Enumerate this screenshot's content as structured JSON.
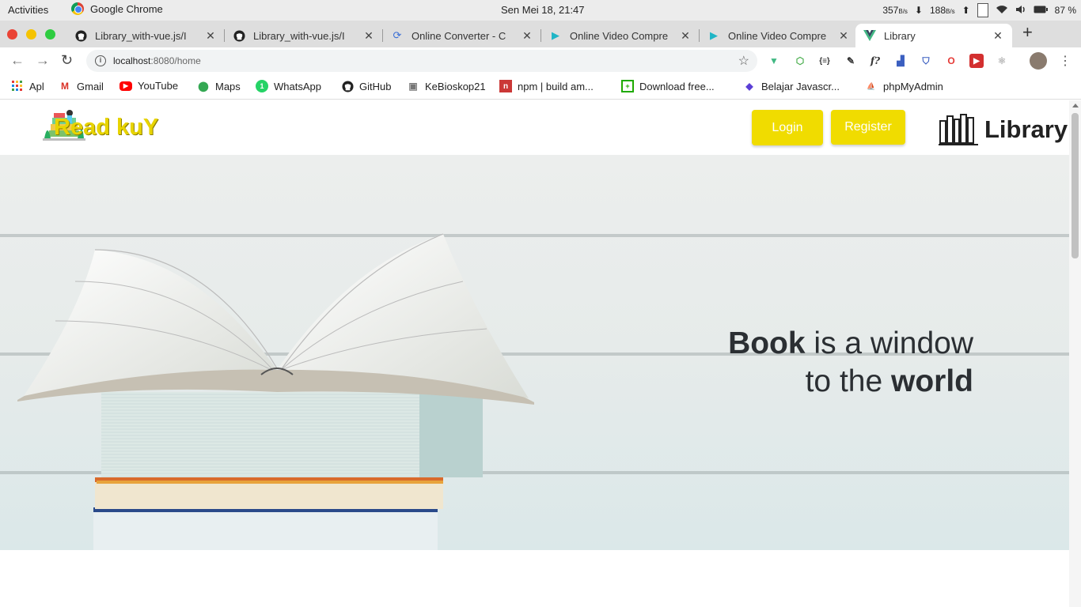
{
  "system_bar": {
    "activities": "Activities",
    "app_name": "Google Chrome",
    "clock": "Sen Mei 18, 21:47",
    "download_speed": "357",
    "download_unit": "B/s",
    "upload_speed": "188",
    "upload_unit": "B/s",
    "battery": "87 %"
  },
  "tabs": [
    {
      "title": "Library_with-vue.js/I",
      "icon": "github-icon"
    },
    {
      "title": "Library_with-vue.js/I",
      "icon": "github-icon"
    },
    {
      "title": "Online Converter - C",
      "icon": "converter-icon"
    },
    {
      "title": "Online Video Compre",
      "icon": "video-compress-icon"
    },
    {
      "title": "Online Video Compre",
      "icon": "video-compress-icon"
    },
    {
      "title": "Library",
      "icon": "vue-icon",
      "active": true
    }
  ],
  "address_bar": {
    "host": "localhost",
    "path": ":8080/home"
  },
  "bookmarks": [
    {
      "label": "Apl",
      "icon": "apps-grid-icon"
    },
    {
      "label": "Gmail",
      "icon": "gmail-icon"
    },
    {
      "label": "YouTube",
      "icon": "youtube-icon"
    },
    {
      "label": "Maps",
      "icon": "maps-icon"
    },
    {
      "label": "WhatsApp",
      "icon": "whatsapp-icon"
    },
    {
      "label": "GitHub",
      "icon": "github-icon"
    },
    {
      "label": "KeBioskop21",
      "icon": "kebioskop-icon"
    },
    {
      "label": "npm | build am...",
      "icon": "npm-icon"
    },
    {
      "label": "Download free...",
      "icon": "download-icon"
    },
    {
      "label": "Belajar Javascr...",
      "icon": "code-icon"
    },
    {
      "label": "phpMyAdmin",
      "icon": "phpmyadmin-icon"
    }
  ],
  "site": {
    "brand": "Read kuY",
    "login": "Login",
    "register": "Register",
    "library_label": "Library",
    "hero": {
      "word1": "Book",
      "line1_rest": " is a window",
      "line2_start": "to the ",
      "word2": "world"
    }
  },
  "colors": {
    "accent": "#f0dc00",
    "brand_text": "#e8d400",
    "hero_text": "#2b2f33"
  }
}
